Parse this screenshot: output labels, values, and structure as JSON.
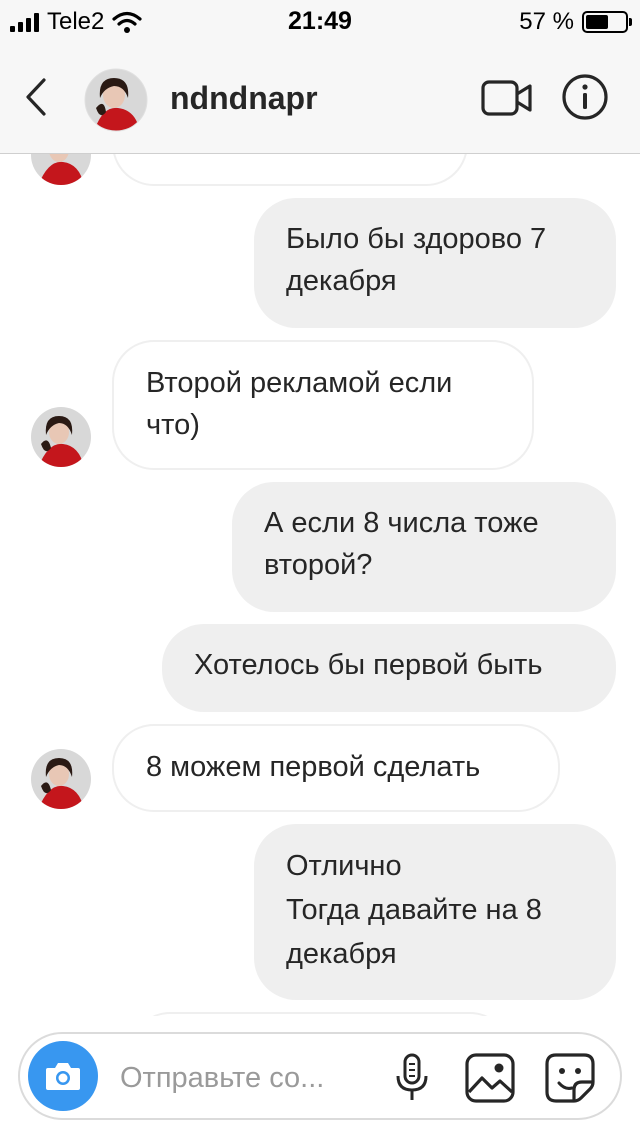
{
  "status_bar": {
    "carrier": "Tele2",
    "time": "21:49",
    "battery_text": "57 %",
    "battery_level": 0.57
  },
  "header": {
    "username": "ndndnapr",
    "icons": {
      "back": "chevron-left-icon",
      "video": "video-camera-icon",
      "info": "info-icon"
    }
  },
  "messages": [
    {
      "direction": "incoming",
      "text": "",
      "partial": true
    },
    {
      "direction": "outgoing",
      "text": "Было бы здорово 7\nдекабря"
    },
    {
      "direction": "incoming",
      "text": "Второй рекламой если\nчто)"
    },
    {
      "direction": "outgoing",
      "text": "А если 8 числа тоже\nвторой?"
    },
    {
      "direction": "outgoing",
      "text": "Хотелось бы первой быть"
    },
    {
      "direction": "incoming",
      "text": "8 можем первой сделать"
    },
    {
      "direction": "outgoing",
      "text": "Отлично\nТогда давайте на 8\nдекабря"
    }
  ],
  "composer": {
    "placeholder": "Отправьте со...",
    "value": "",
    "icons": {
      "camera": "camera-icon",
      "mic": "microphone-icon",
      "gallery": "image-icon",
      "sticker": "sticker-icon"
    },
    "accent": "#3897f0"
  },
  "colors": {
    "incoming_bubble": "#ffffff",
    "incoming_border": "#efefef",
    "outgoing_bubble": "#efefef",
    "header_bg": "#f7f7f7"
  }
}
